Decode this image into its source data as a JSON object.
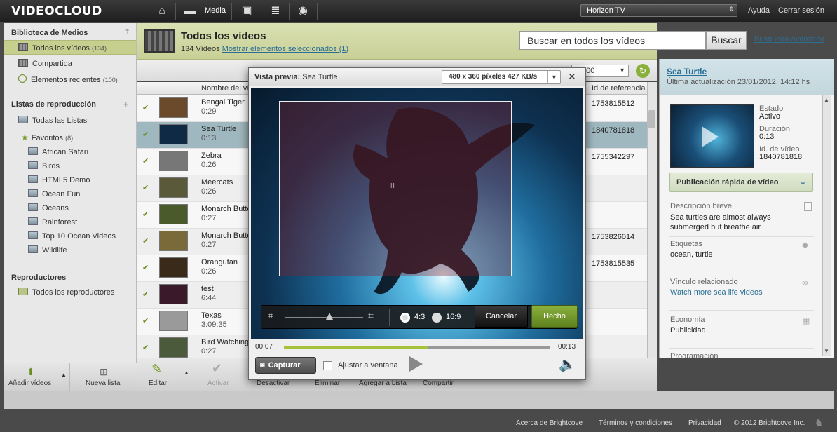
{
  "app": {
    "logo": "VIDEOCLOUD",
    "media_label": "Media",
    "account": "Horizon TV",
    "help": "Ayuda",
    "logout": "Cerrar sesión"
  },
  "sidebar": {
    "library_title": "Biblioteca de Medios",
    "library_items": [
      {
        "label": "Todos los vídeos",
        "count": "(134)"
      },
      {
        "label": "Compartida",
        "count": ""
      },
      {
        "label": "Elementos recientes",
        "count": "(100)"
      }
    ],
    "playlists_title": "Listas de reproducción",
    "all_lists": "Todas las Listas",
    "favorites": {
      "label": "Favoritos",
      "count": "(8)"
    },
    "playlists": [
      "African Safari",
      "Birds",
      "HTML5 Demo",
      "Ocean Fun",
      "Oceans",
      "Rainforest",
      "Top 10 Ocean Videos",
      "Wildlife"
    ],
    "players_title": "Reproductores",
    "all_players": "Todos los reproductores",
    "add_videos": "Añadir vídeos",
    "new_list": "Nueva lista"
  },
  "main": {
    "title": "Todos los vídeos",
    "count_text": "134 Vídeos",
    "show_selected": "Mostrar elementos seleccionados (1)",
    "search_placeholder": "Buscar en todos los vídeos",
    "search_button": "Buscar",
    "advanced_search": "Búsqueda avanzada",
    "col_name": "Nombre del ví",
    "col_ref": "Id de referencia",
    "per_page": "100"
  },
  "rows": [
    {
      "name": "Bengal Tiger",
      "dur": "0:29",
      "ref": "1753815512"
    },
    {
      "name": "Sea Turtle",
      "dur": "0:13",
      "ref": "1840781818"
    },
    {
      "name": "Zebra",
      "dur": "0:26",
      "ref": "1755342297"
    },
    {
      "name": "Meercats",
      "dur": "0:26",
      "ref": ""
    },
    {
      "name": "Monarch Butte",
      "dur": "0:27",
      "ref": ""
    },
    {
      "name": "Monarch Butte",
      "dur": "0:27",
      "ref": "1753826014"
    },
    {
      "name": "Orangutan",
      "dur": "0:26",
      "ref": "1753815535"
    },
    {
      "name": "test",
      "dur": "6:44",
      "ref": ""
    },
    {
      "name": "Texas",
      "dur": "3:09:35",
      "ref": ""
    },
    {
      "name": "Bird Watching",
      "dur": "0:27",
      "ref": ""
    }
  ],
  "toolbar": {
    "edit": "Editar",
    "activate": "Activar",
    "deactivate": "Desactivar",
    "delete": "Eliminar",
    "add_to_list": "Agregar a Lista",
    "share": "Compartir"
  },
  "detail": {
    "title": "Sea Turtle",
    "updated": "Última actualización 23/01/2012, 14:12 hs",
    "state_label": "Estado",
    "state_value": "Activo",
    "duration_label": "Duración",
    "duration_value": "0:13",
    "id_label": "Id. de vídeo",
    "id_value": "1840781818",
    "quick_publish": "Publicación rápida de vídeo",
    "short_desc_label": "Descripción breve",
    "short_desc_value": "Sea turtles are almost always submerged but breathe air.",
    "tags_label": "Etiquetas",
    "tags_value": "ocean, turtle",
    "link_label": "Vínculo relacionado",
    "link_value": "Watch more sea life videos",
    "economy_label": "Economía",
    "economy_value": "Publicidad",
    "programming_label": "Programación"
  },
  "modal": {
    "title_label": "Vista previa:",
    "title_value": "Sea Turtle",
    "resolution": "480 x 360 píxeles 427 KB/s",
    "ratio_43": "4:3",
    "ratio_169": "16:9",
    "cancel": "Cancelar",
    "done": "Hecho",
    "time_current": "00:07",
    "time_total": "00:13",
    "progress": 0.54,
    "capture": "Capturar",
    "fit_window": "Ajustar a ventana"
  },
  "footer": {
    "about": "Acerca de Brightcove",
    "terms": "Términos y condiciones",
    "privacy": "Privacidad",
    "copyright": "© 2012 Brightcove Inc."
  }
}
